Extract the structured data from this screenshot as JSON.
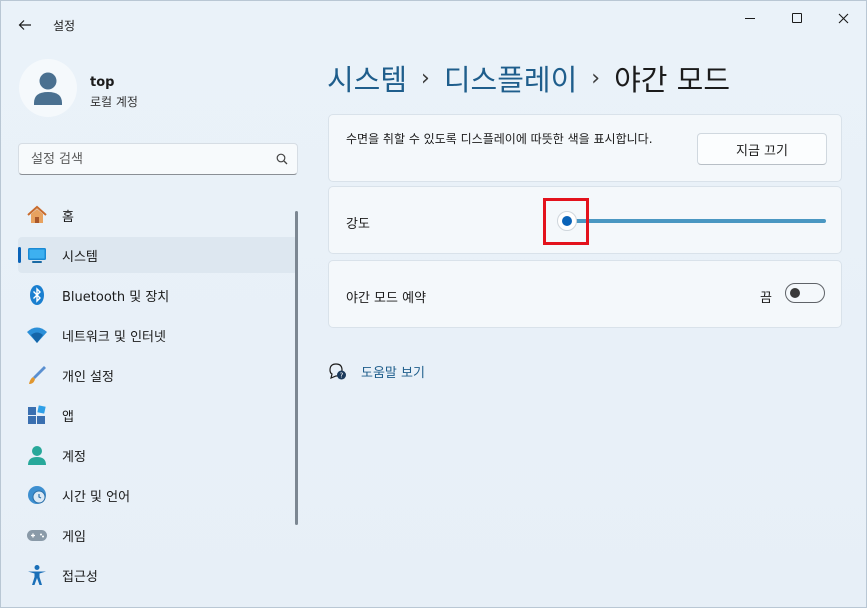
{
  "window": {
    "app_title": "설정",
    "back_icon": "back-arrow-icon",
    "controls": [
      "minimize",
      "maximize",
      "close"
    ]
  },
  "profile": {
    "name": "top",
    "account_type": "로컬 계정"
  },
  "search": {
    "placeholder": "설정 검색",
    "icon": "search-icon"
  },
  "sidebar": {
    "items": [
      {
        "label": "홈",
        "icon": "home-icon",
        "active": false
      },
      {
        "label": "시스템",
        "icon": "system-monitor-icon",
        "active": true
      },
      {
        "label": "Bluetooth 및 장치",
        "icon": "bluetooth-icon",
        "active": false
      },
      {
        "label": "네트워크 및 인터넷",
        "icon": "wifi-icon",
        "active": false
      },
      {
        "label": "개인 설정",
        "icon": "brush-icon",
        "active": false
      },
      {
        "label": "앱",
        "icon": "apps-icon",
        "active": false
      },
      {
        "label": "계정",
        "icon": "account-icon",
        "active": false
      },
      {
        "label": "시간 및 언어",
        "icon": "globe-clock-icon",
        "active": false
      },
      {
        "label": "게임",
        "icon": "gamepad-icon",
        "active": false
      },
      {
        "label": "접근성",
        "icon": "accessibility-icon",
        "active": false
      }
    ]
  },
  "breadcrumb": {
    "parts": [
      "시스템",
      "디스플레이"
    ],
    "current": "야간 모드",
    "separator": "›"
  },
  "description_card": {
    "text": "수면을 취할 수 있도록 디스플레이에 따뜻한 색을 표시합니다.",
    "button_label": "지금 끄기"
  },
  "strength_card": {
    "label": "강도",
    "slider_value_percent": 0
  },
  "schedule_card": {
    "label": "야간 모드 예약",
    "toggle_state_label": "끔",
    "toggle_on": false
  },
  "help": {
    "label": "도움말 보기",
    "icon": "help-chat-icon"
  },
  "colors": {
    "accent": "#0a63b8",
    "breadcrumb_link": "#1f5e8c",
    "highlight": "#e3121c",
    "background": "#e9f1f8"
  }
}
